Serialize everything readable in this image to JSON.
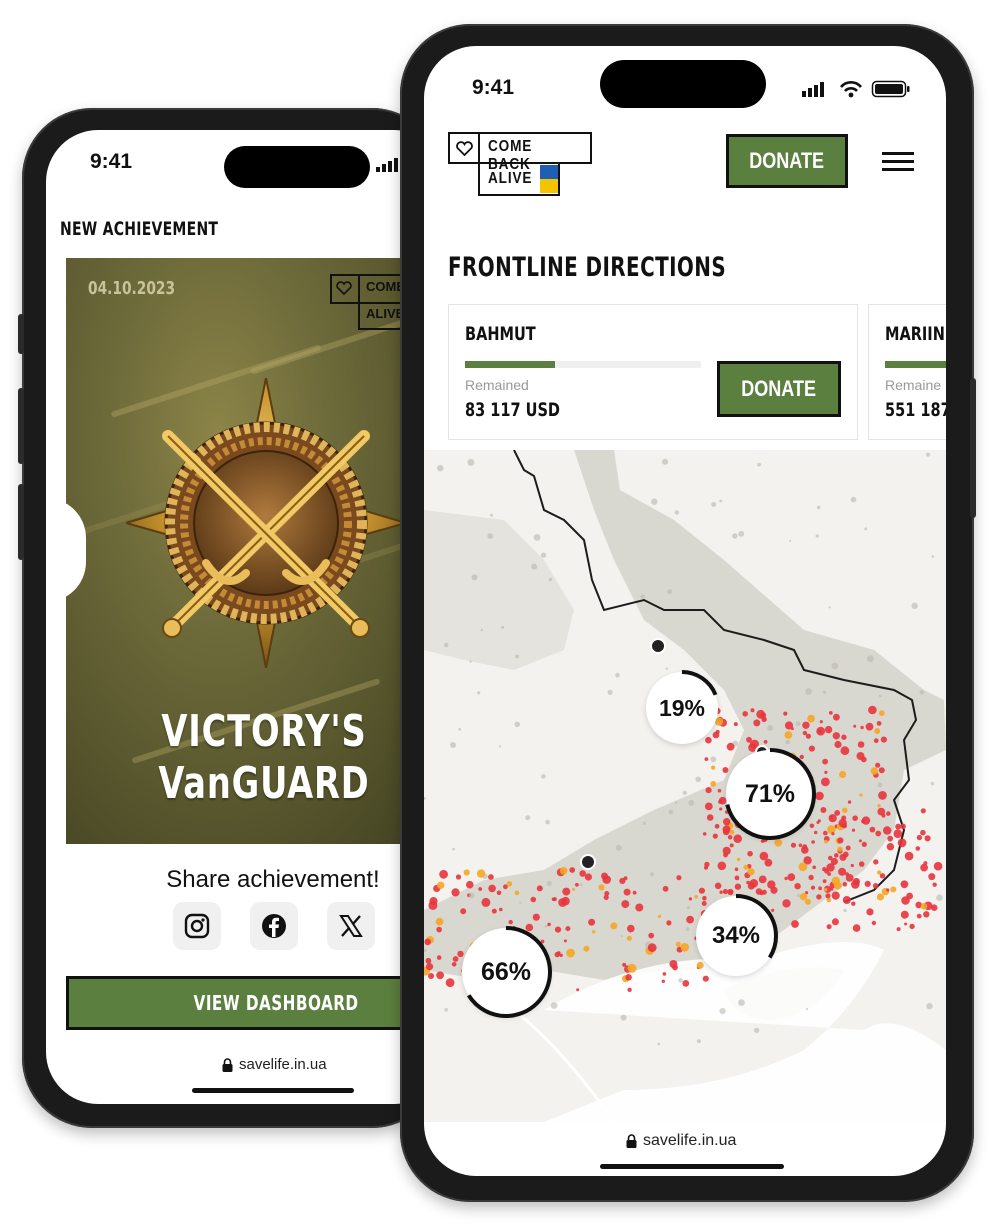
{
  "achievement_screen": {
    "status_time": "9:41",
    "header": "NEW ACHIEVEMENT",
    "card": {
      "date": "04.10.2023",
      "logo_line1": "COME BACK",
      "logo_line2": "ALIVE",
      "title_line1": "VICTORY'S",
      "title_line2": "VanGUARD"
    },
    "share_label": "Share achievement!",
    "socials": [
      {
        "icon": "instagram-icon"
      },
      {
        "icon": "facebook-icon"
      },
      {
        "icon": "x-icon"
      }
    ],
    "view_button": "VIEW DASHBOARD",
    "url": "savelife.in.ua"
  },
  "frontline_screen": {
    "status_time": "9:41",
    "logo": {
      "line1": "COME BACK",
      "line2": "ALIVE"
    },
    "donate_button": "DONATE",
    "section_title": "FRONTLINE DIRECTIONS",
    "directions": [
      {
        "name": "BAHMUT",
        "remained_label": "Remained",
        "remained_value": "83 117 USD",
        "progress": 0.38,
        "donate": "DONATE"
      },
      {
        "name": "MARIIN",
        "remained_label": "Remaine",
        "remained_value": "551 187",
        "progress": 0.6
      }
    ],
    "map_badges": [
      {
        "label": "19%",
        "value": 0.19
      },
      {
        "label": "71%",
        "value": 0.71
      },
      {
        "label": "34%",
        "value": 0.34
      },
      {
        "label": "66%",
        "value": 0.66
      }
    ],
    "url": "savelife.in.ua"
  },
  "colors": {
    "brand_green": "#5b7f3e",
    "ua_blue": "#1f5fb3",
    "ua_yellow": "#f5c400",
    "frontline_red": "#e8343d",
    "frontline_orange": "#f6a623"
  }
}
